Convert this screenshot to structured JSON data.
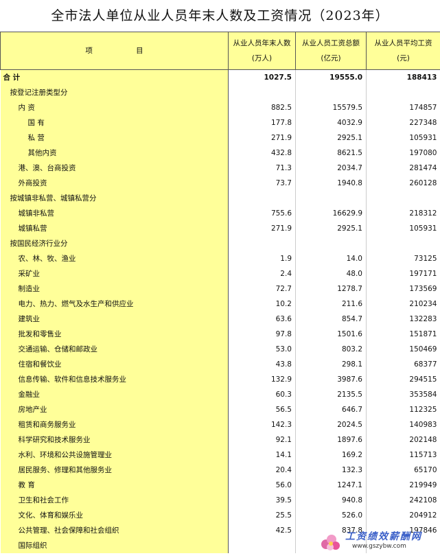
{
  "title": "全市法人单位从业人员年末人数及工资情况（2023年）",
  "headers": {
    "item": "项 目",
    "col1_line1": "从业人员年末人数",
    "col1_line2": "(万人)",
    "col2_line1": "从业人员工资总额",
    "col2_line2": "(亿元)",
    "col3_line1": "从业人员平均工资",
    "col3_line2": "(元)"
  },
  "rows": [
    {
      "label": "合 计",
      "indent": 0,
      "c1": "1027.5",
      "c2": "19555.0",
      "c3": "188413",
      "total": true
    },
    {
      "label": "按登记注册类型分",
      "indent": 1,
      "c1": "",
      "c2": "",
      "c3": ""
    },
    {
      "label": "内 资",
      "indent": 2,
      "c1": "882.5",
      "c2": "15579.5",
      "c3": "174857"
    },
    {
      "label": "国 有",
      "indent": 3,
      "c1": "177.8",
      "c2": "4032.9",
      "c3": "227348"
    },
    {
      "label": "私 营",
      "indent": 3,
      "c1": "271.9",
      "c2": "2925.1",
      "c3": "105931"
    },
    {
      "label": "其他内资",
      "indent": 3,
      "c1": "432.8",
      "c2": "8621.5",
      "c3": "197080"
    },
    {
      "label": "港、澳、台商投资",
      "indent": 2,
      "c1": "71.3",
      "c2": "2034.7",
      "c3": "281474"
    },
    {
      "label": "外商投资",
      "indent": 2,
      "c1": "73.7",
      "c2": "1940.8",
      "c3": "260128"
    },
    {
      "label": "按城镇非私营、城镇私营分",
      "indent": 1,
      "c1": "",
      "c2": "",
      "c3": ""
    },
    {
      "label": "城镇非私营",
      "indent": 2,
      "c1": "755.6",
      "c2": "16629.9",
      "c3": "218312"
    },
    {
      "label": "城镇私营",
      "indent": 2,
      "c1": "271.9",
      "c2": "2925.1",
      "c3": "105931"
    },
    {
      "label": "按国民经济行业分",
      "indent": 1,
      "c1": "",
      "c2": "",
      "c3": ""
    },
    {
      "label": "农、林、牧、渔业",
      "indent": 2,
      "c1": "1.9",
      "c2": "14.0",
      "c3": "73125"
    },
    {
      "label": "采矿业",
      "indent": 2,
      "c1": "2.4",
      "c2": "48.0",
      "c3": "197171"
    },
    {
      "label": "制造业",
      "indent": 2,
      "c1": "72.7",
      "c2": "1278.7",
      "c3": "173569"
    },
    {
      "label": "电力、热力、燃气及水生产和供应业",
      "indent": 2,
      "c1": "10.2",
      "c2": "211.6",
      "c3": "210234"
    },
    {
      "label": "建筑业",
      "indent": 2,
      "c1": "63.6",
      "c2": "854.7",
      "c3": "132283"
    },
    {
      "label": "批发和零售业",
      "indent": 2,
      "c1": "97.8",
      "c2": "1501.6",
      "c3": "151871"
    },
    {
      "label": "交通运输、仓储和邮政业",
      "indent": 2,
      "c1": "53.0",
      "c2": "803.2",
      "c3": "150469"
    },
    {
      "label": "住宿和餐饮业",
      "indent": 2,
      "c1": "43.8",
      "c2": "298.1",
      "c3": "68377"
    },
    {
      "label": "信息传输、软件和信息技术服务业",
      "indent": 2,
      "c1": "132.9",
      "c2": "3987.6",
      "c3": "294515"
    },
    {
      "label": "金融业",
      "indent": 2,
      "c1": "60.3",
      "c2": "2135.5",
      "c3": "353584"
    },
    {
      "label": "房地产业",
      "indent": 2,
      "c1": "56.5",
      "c2": "646.7",
      "c3": "112325"
    },
    {
      "label": "租赁和商务服务业",
      "indent": 2,
      "c1": "142.3",
      "c2": "2024.5",
      "c3": "140983"
    },
    {
      "label": "科学研究和技术服务业",
      "indent": 2,
      "c1": "92.1",
      "c2": "1897.6",
      "c3": "202148"
    },
    {
      "label": "水利、环境和公共设施管理业",
      "indent": 2,
      "c1": "14.1",
      "c2": "169.2",
      "c3": "115713"
    },
    {
      "label": "居民服务、修理和其他服务业",
      "indent": 2,
      "c1": "20.4",
      "c2": "132.3",
      "c3": "65170"
    },
    {
      "label": "教 育",
      "indent": 2,
      "c1": "56.0",
      "c2": "1247.1",
      "c3": "219949"
    },
    {
      "label": "卫生和社会工作",
      "indent": 2,
      "c1": "39.5",
      "c2": "940.8",
      "c3": "242108"
    },
    {
      "label": "文化、体育和娱乐业",
      "indent": 2,
      "c1": "25.5",
      "c2": "526.0",
      "c3": "204912"
    },
    {
      "label": "公共管理、社会保障和社会组织",
      "indent": 2,
      "c1": "42.5",
      "c2": "837.8",
      "c3": "197846"
    },
    {
      "label": "国际组织",
      "indent": 2,
      "c1": "",
      "c2": "",
      "c3": ""
    }
  ],
  "watermark": {
    "text": "工资绩效薪酬网",
    "url": "www.gszybw.com"
  },
  "colors": {
    "header_bg": "#ffff99",
    "watermark_blue": "#3a5fc8"
  }
}
